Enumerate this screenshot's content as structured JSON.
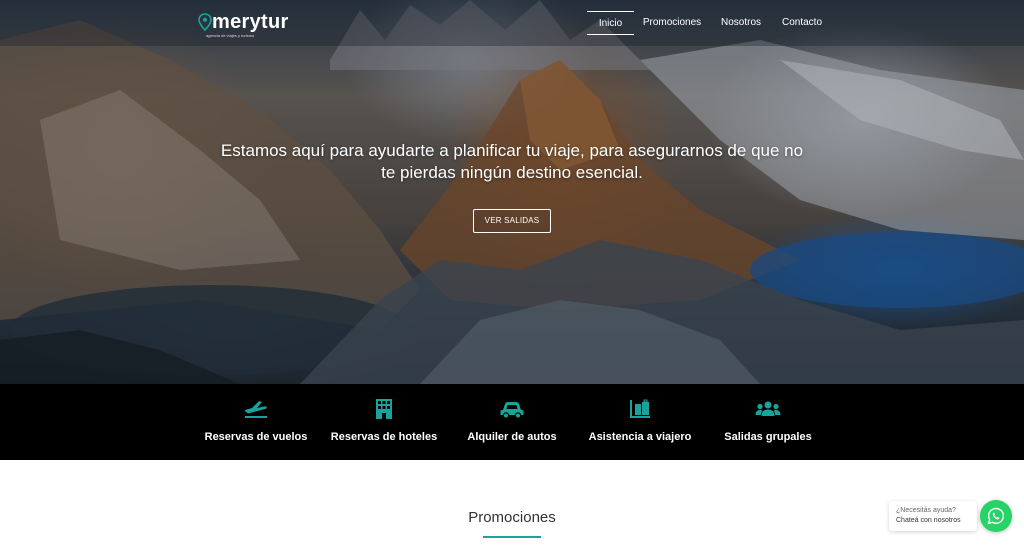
{
  "brand": {
    "name": "merytur",
    "tagline": "agencia de viajes y turismo",
    "accent_color": "#1aa39a",
    "icon": "map-pin-icon"
  },
  "nav": {
    "items": [
      {
        "label": "Inicio",
        "active": true
      },
      {
        "label": "Promociones",
        "active": false
      },
      {
        "label": "Nosotros",
        "active": false
      },
      {
        "label": "Contacto",
        "active": false
      }
    ]
  },
  "hero": {
    "title": "Estamos aquí para ayudarte a planificar tu viaje, para asegurarnos de que no te pierdas ningún destino esencial.",
    "cta_label": "VER SALIDAS"
  },
  "services": [
    {
      "label": "Reservas de vuelos",
      "icon": "plane-icon"
    },
    {
      "label": "Reservas de hoteles",
      "icon": "hotel-icon"
    },
    {
      "label": "Alquiler de autos",
      "icon": "car-icon"
    },
    {
      "label": "Asistencia a viajero",
      "icon": "luggage-icon"
    },
    {
      "label": "Salidas grupales",
      "icon": "group-icon"
    }
  ],
  "promotions": {
    "title": "Promociones"
  },
  "whatsapp": {
    "line1": "¿Necesitás ayuda?",
    "line2": "Chateá con nosotros",
    "icon": "whatsapp-icon",
    "color": "#25d366"
  }
}
